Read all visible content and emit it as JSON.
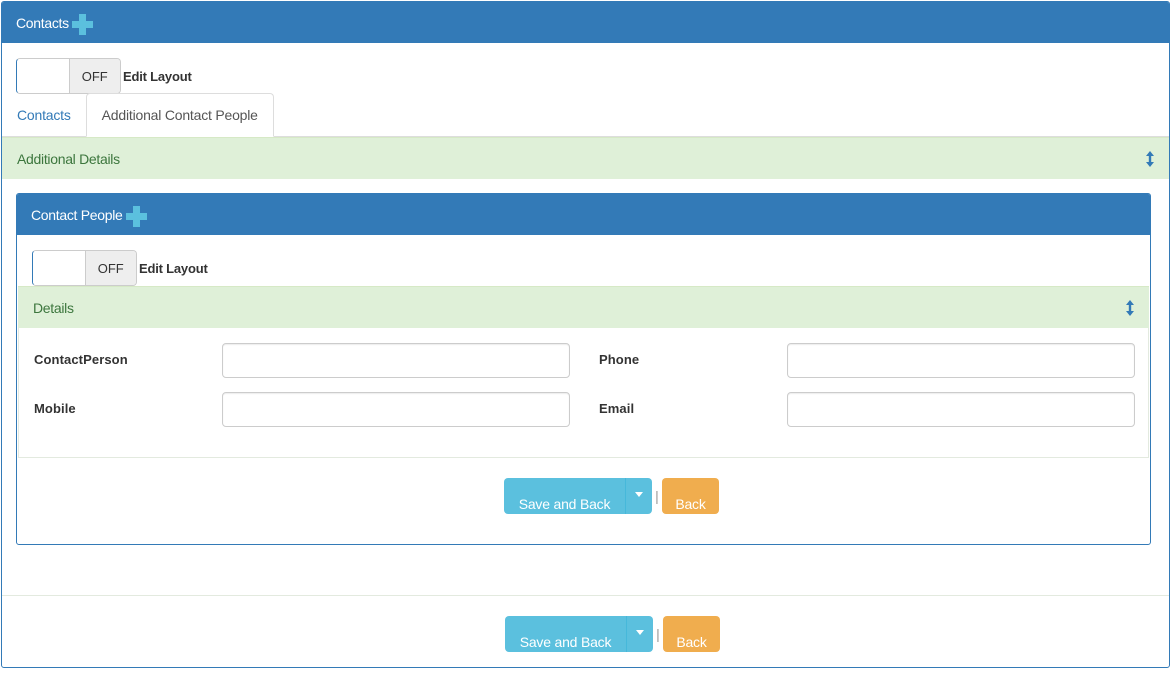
{
  "outer": {
    "title": "Contacts",
    "add_icon": "plus-icon",
    "toggle_state": "OFF",
    "edit_layout_label": "Edit Layout",
    "tabs": [
      {
        "label": "Contacts",
        "active": false
      },
      {
        "label": "Additional Contact People",
        "active": true
      }
    ],
    "section_title": "Additional Details",
    "section_icon": "updown-arrow-icon",
    "actions": {
      "save_label": "Save and Back",
      "caret_icon": "caret-down-icon",
      "separator": "|",
      "back_label": "Back"
    }
  },
  "inner": {
    "title": "Contact People",
    "add_icon": "plus-icon",
    "toggle_state": "OFF",
    "edit_layout_label": "Edit Layout",
    "section_title": "Details",
    "section_icon": "updown-arrow-icon",
    "fields": {
      "contact_person": {
        "label": "ContactPerson",
        "value": ""
      },
      "phone": {
        "label": "Phone",
        "value": ""
      },
      "mobile": {
        "label": "Mobile",
        "value": ""
      },
      "email": {
        "label": "Email",
        "value": ""
      }
    },
    "actions": {
      "save_label": "Save and Back",
      "caret_icon": "caret-down-icon",
      "separator": "|",
      "back_label": "Back"
    }
  },
  "colors": {
    "primary": "#337ab7",
    "plus_icon": "#5bc0de",
    "section_bg": "#dff0d8",
    "section_text": "#3c763d",
    "info_button": "#5bc0de",
    "warning_button": "#f0ad4e"
  }
}
